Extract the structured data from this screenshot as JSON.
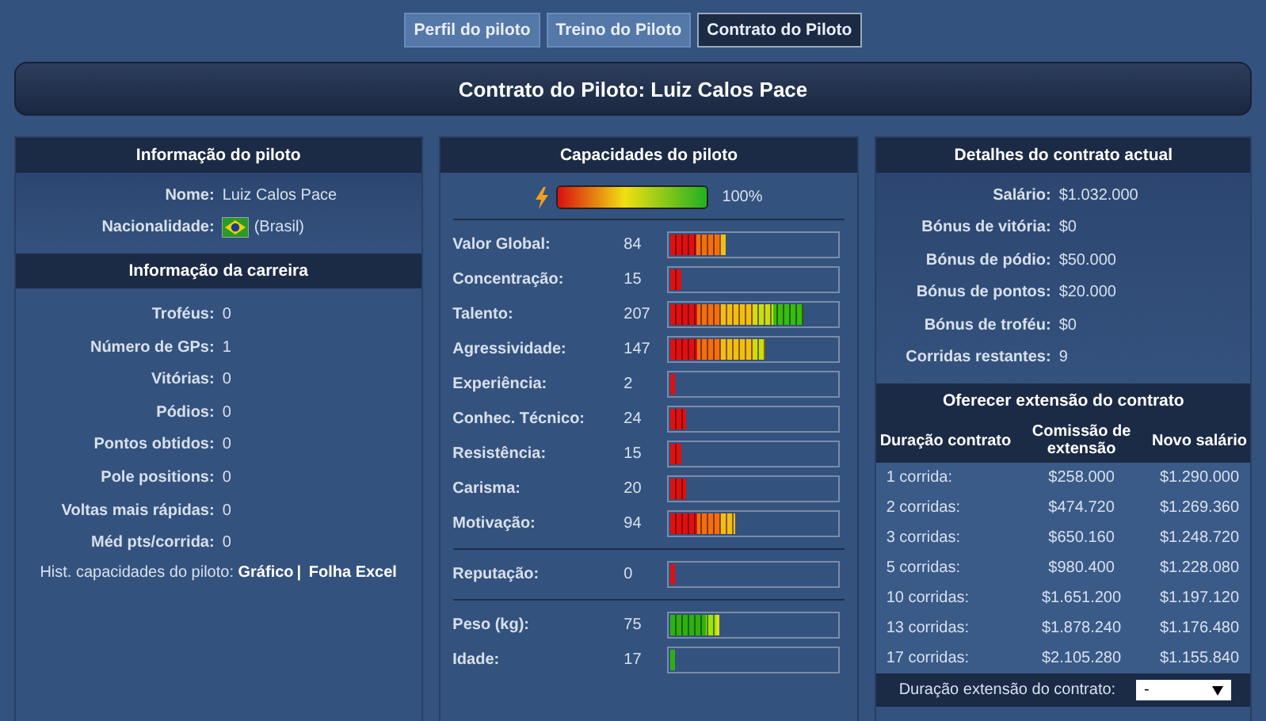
{
  "tabs": [
    {
      "label": "Perfil do piloto",
      "selected": false
    },
    {
      "label": "Treino do Piloto",
      "selected": false
    },
    {
      "label": "Contrato do Piloto",
      "selected": true
    }
  ],
  "title": "Contrato do Piloto: Luiz Calos Pace",
  "pilot_info": {
    "header": "Informação do piloto",
    "fields": [
      {
        "label": "Nome:",
        "value": "Luiz Calos Pace"
      },
      {
        "label": "Nacionalidade:",
        "value": "(Brasil)",
        "flag": true
      }
    ]
  },
  "career": {
    "header": "Informação da carreira",
    "fields": [
      {
        "label": "Troféus:",
        "value": "0"
      },
      {
        "label": "Número de GPs:",
        "value": "1"
      },
      {
        "label": "Vitórias:",
        "value": "0"
      },
      {
        "label": "Pódios:",
        "value": "0"
      },
      {
        "label": "Pontos obtidos:",
        "value": "0"
      },
      {
        "label": "Pole positions:",
        "value": "0"
      },
      {
        "label": "Voltas mais rápidas:",
        "value": "0"
      },
      {
        "label": "Méd pts/corrida:",
        "value": "0"
      }
    ],
    "history": {
      "label": "Hist. capacidades do piloto:",
      "links": [
        "Gráfico",
        "Folha Excel"
      ],
      "separator": "|"
    }
  },
  "abilities": {
    "header": "Capacidades do piloto",
    "energy": {
      "level": 1,
      "reading": "100%"
    },
    "groups": [
      [
        {
          "label": "Valor Global:",
          "value": "84",
          "level": 0.34,
          "kind": "skill"
        },
        {
          "label": "Concentração:",
          "value": "15",
          "level": 0.07,
          "kind": "skill"
        },
        {
          "label": "Talento:",
          "value": "207",
          "level": 0.8,
          "kind": "skill"
        },
        {
          "label": "Agressividade:",
          "value": "147",
          "level": 0.57,
          "kind": "skill"
        },
        {
          "label": "Experiência:",
          "value": "2",
          "level": 0.03,
          "kind": "skill"
        },
        {
          "label": "Conhec. Técnico:",
          "value": "24",
          "level": 0.1,
          "kind": "skill"
        },
        {
          "label": "Resistência:",
          "value": "15",
          "level": 0.07,
          "kind": "skill"
        },
        {
          "label": "Carisma:",
          "value": "20",
          "level": 0.1,
          "kind": "skill"
        },
        {
          "label": "Motivação:",
          "value": "94",
          "level": 0.39,
          "kind": "skill"
        }
      ],
      [
        {
          "label": "Reputação:",
          "value": "0",
          "level": 0.03,
          "kind": "skill"
        }
      ],
      [
        {
          "label": "Peso (kg):",
          "value": "75",
          "level": 0.3,
          "kind": "physical"
        },
        {
          "label": "Idade:",
          "value": "17",
          "level": 0.03,
          "kind": "physical"
        }
      ]
    ]
  },
  "contract": {
    "header": "Detalhes do contrato actual",
    "fields": [
      {
        "label": "Salário:",
        "value": "$1.032.000"
      },
      {
        "label": "Bónus de vitória:",
        "value": "$0"
      },
      {
        "label": "Bónus de pódio:",
        "value": "$50.000"
      },
      {
        "label": "Bónus de pontos:",
        "value": "$20.000"
      },
      {
        "label": "Bónus de troféu:",
        "value": "$0"
      },
      {
        "label": "Corridas restantes:",
        "value": "9"
      }
    ]
  },
  "extension": {
    "header": "Oferecer extensão do contrato",
    "columns": [
      "Duração contrato",
      "Comissão de extensão",
      "Novo salário"
    ],
    "rows": [
      [
        "1 corrida:",
        "$258.000",
        "$1.290.000"
      ],
      [
        "2 corridas:",
        "$474.720",
        "$1.269.360"
      ],
      [
        "3 corridas:",
        "$650.160",
        "$1.248.720"
      ],
      [
        "5 corridas:",
        "$980.400",
        "$1.228.080"
      ],
      [
        "10 corridas:",
        "$1.651.200",
        "$1.197.120"
      ],
      [
        "13 corridas:",
        "$1.878.240",
        "$1.176.480"
      ],
      [
        "17 corridas:",
        "$2.105.280",
        "$1.155.840"
      ]
    ],
    "duration": {
      "label": "Duração extensão do contrato:",
      "value": "-"
    }
  }
}
